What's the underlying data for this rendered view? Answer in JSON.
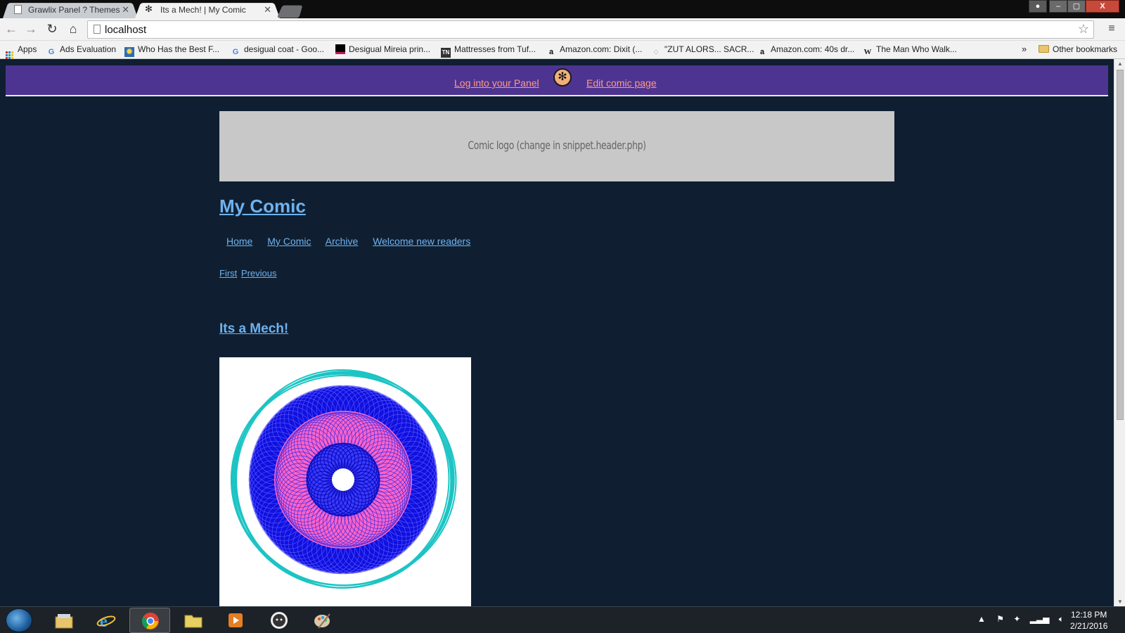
{
  "browser": {
    "tabs": [
      {
        "label": "Grawlix Panel ? Themes",
        "active": false
      },
      {
        "label": "Its a Mech! | My Comic",
        "active": true
      }
    ],
    "window_controls": {
      "close": "X"
    },
    "address": "localhost",
    "bookmarks": [
      {
        "label": "Apps",
        "icon": "apps-icon"
      },
      {
        "label": "Ads Evaluation",
        "icon": "google-icon"
      },
      {
        "label": "Who Has the Best F...",
        "icon": "site-icon"
      },
      {
        "label": "desigual coat - Goo...",
        "icon": "google-icon"
      },
      {
        "label": "Desigual Mireia prin...",
        "icon": "site-icon"
      },
      {
        "label": "Mattresses from Tuf...",
        "icon": "tn-icon"
      },
      {
        "label": "Amazon.com: Dixit (...",
        "icon": "amazon-icon"
      },
      {
        "label": "\"ZUT ALORS... SACR...",
        "icon": "site-icon"
      },
      {
        "label": "Amazon.com: 40s dr...",
        "icon": "amazon-icon"
      },
      {
        "label": "The Man Who Walk...",
        "icon": "wikipedia-icon"
      }
    ],
    "bookmarks_more": "»",
    "other_bookmarks": "Other bookmarks"
  },
  "admin_bar": {
    "login_link": "Log into your Panel",
    "edit_link": "Edit comic page"
  },
  "header": {
    "logo_placeholder": "Comic logo (change in snippet.header.php)",
    "site_title": "My Comic"
  },
  "nav": [
    "Home",
    "My Comic",
    "Archive",
    "Welcome new readers"
  ],
  "pager": {
    "first": "First",
    "previous": "Previous"
  },
  "comic": {
    "title": "Its a Mech!"
  },
  "taskbar": {
    "apps": [
      "explorer-icon",
      "internet-explorer-icon",
      "chrome-icon",
      "folder-icon",
      "media-player-icon",
      "github-icon",
      "paint-icon"
    ],
    "active_app": "chrome-icon",
    "time": "12:18 PM",
    "date": "2/21/2016"
  },
  "colors": {
    "page_bg": "#0f1f31",
    "admin_bar_bg": "#4e3491",
    "admin_link": "#ff9a86",
    "link": "#6fb2f0",
    "logo_box": "#c8c8c8"
  }
}
